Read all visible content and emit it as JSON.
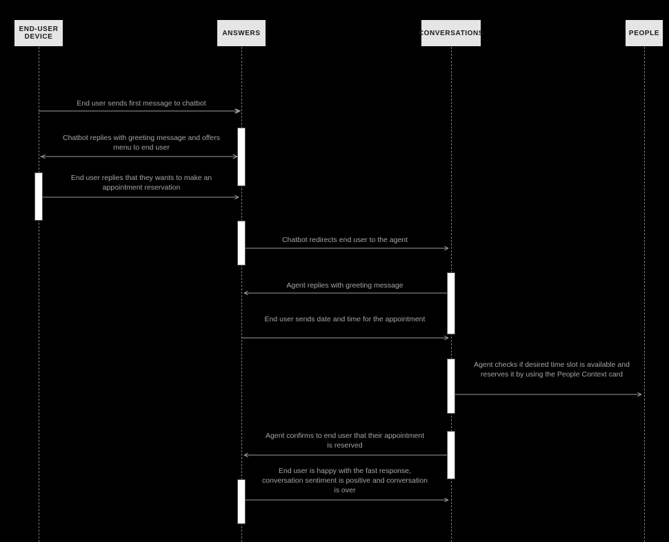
{
  "participants": {
    "endUser": "END-USER DEVICE",
    "answers": "ANSWERS",
    "conversations": "CONVERSATIONS",
    "people": "PEOPLE"
  },
  "messages": {
    "m1": "End user sends first message to chatbot",
    "m2": "Chatbot replies with greeting message and offers menu to end user",
    "m3": "End user replies that they wants to make an appointment reservation",
    "m4": "Chatbot redirects end user to the agent",
    "m5": "Agent replies with greeting message",
    "m6": "End user sends date and time for the appointment",
    "m7": "Agent checks if desired time slot is available and reserves it by using the People Context card",
    "m8": "Agent confirms to end user that their appointment is reserved",
    "m9": "End user is happy with the fast response, conversation sentiment is positive and conversation is over"
  },
  "chart_data": {
    "type": "sequence_diagram",
    "participants": [
      "END-USER DEVICE",
      "ANSWERS",
      "CONVERSATIONS",
      "PEOPLE"
    ],
    "interactions": [
      {
        "from": "END-USER DEVICE",
        "to": "ANSWERS",
        "label": "End user sends first message to chatbot"
      },
      {
        "from": "ANSWERS",
        "to": "END-USER DEVICE",
        "label": "Chatbot replies with greeting message and offers menu to end user"
      },
      {
        "from": "END-USER DEVICE",
        "to": "ANSWERS",
        "label": "End user replies that they wants to make an appointment reservation"
      },
      {
        "from": "ANSWERS",
        "to": "CONVERSATIONS",
        "label": "Chatbot redirects end user to the agent"
      },
      {
        "from": "CONVERSATIONS",
        "to": "ANSWERS",
        "label": "Agent replies with greeting message"
      },
      {
        "from": "ANSWERS",
        "to": "CONVERSATIONS",
        "label": "End user sends date and time for the appointment"
      },
      {
        "from": "CONVERSATIONS",
        "to": "PEOPLE",
        "label": "Agent checks if desired time slot is available and reserves it by using the People Context card"
      },
      {
        "from": "CONVERSATIONS",
        "to": "ANSWERS",
        "label": "Agent confirms to end user that their appointment is reserved"
      },
      {
        "from": "ANSWERS",
        "to": "CONVERSATIONS",
        "label": "End user is happy with the fast response, conversation sentiment is positive and conversation is over"
      }
    ]
  }
}
